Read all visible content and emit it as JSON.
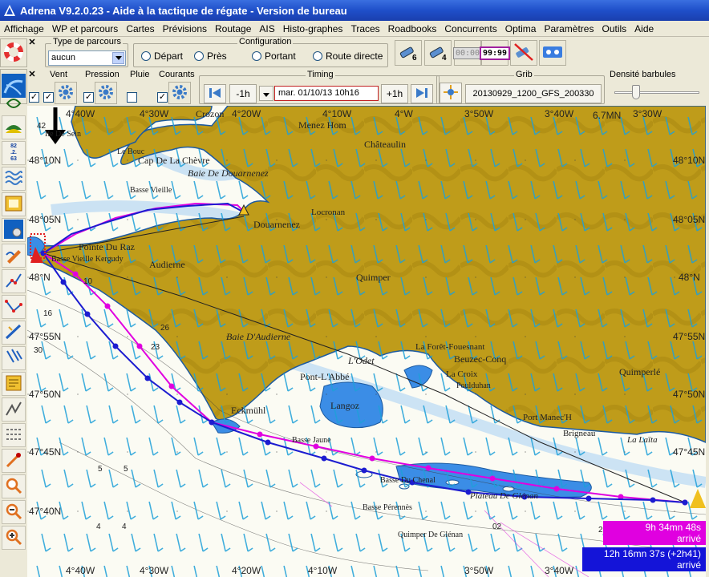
{
  "window": {
    "title": "Adrena V9.2.0.23 - Aide à la tactique de régate - Version de bureau"
  },
  "menu": [
    "Affichage",
    "WP et parcours",
    "Cartes",
    "Prévisions",
    "Routage",
    "AIS",
    "Histo-graphes",
    "Traces",
    "Roadbooks",
    "Concurrents",
    "Optima",
    "Paramètres",
    "Outils",
    "Aide"
  ],
  "toolbar": {
    "course_type_label": "Type de parcours",
    "course_type_value": "aucun",
    "config_label": "Configuration",
    "radios": [
      "Départ",
      "Près",
      "Portant",
      "Route directe"
    ],
    "btn_badge_6": "6",
    "btn_badge_4": "4",
    "btn_time_a": "00:00",
    "btn_time_b": "99:99"
  },
  "toolbar2": {
    "vent": "Vent",
    "pression": "Pression",
    "pluie": "Pluie",
    "courants": "Courants",
    "timing": "Timing",
    "minus_1h": "-1h",
    "date": "mar. 01/10/13 10h16",
    "plus_1h": "+1h",
    "grib_label": "Grib",
    "grib_file": "20130929_1200_GFS_200330",
    "density_label": "Densité barbules"
  },
  "map": {
    "lon_labels": [
      "4°40W",
      "4°30W",
      "4°20W",
      "4°10W",
      "4°W",
      "3°50W",
      "3°40W",
      "3°30W"
    ],
    "lat_labels": [
      "48°10N",
      "48°05N",
      "48°N",
      "47°55N",
      "47°50N",
      "47°45N",
      "47°40N"
    ],
    "places": [
      "Crozon",
      "Menez Hom",
      "Châteaulin",
      "Le Bouc",
      "Cap De La Chèvre",
      "Baie De Douarnenez",
      "Basse Vieille",
      "Douarnenez",
      "Locronan",
      "Pointe Du Raz",
      "Basse Vieille Kergudy",
      "Audierne",
      "Quimper",
      "Baie D'Audierne",
      "L'Odet",
      "La Forêt-Fouesnant",
      "Beuzec-Conq",
      "Pont-L'Abbé",
      "La Croix",
      "Poulduhan",
      "Quimperlé",
      "Langoz",
      "Eckmühl",
      "Port Manec'H",
      "Brigneau",
      "La Laïta",
      "Basse Du Chenal",
      "Basse Jaune",
      "Plateau De Glénan",
      "Basse Pérennès",
      "Quimper De Glénan",
      "Ile De Sein"
    ],
    "distance_label": "6.7MN",
    "depth_labels": [
      "42",
      "16",
      "26",
      "23",
      "5",
      "4",
      "02",
      "10",
      "20",
      "30"
    ],
    "route_magenta_time": "9h 34mn 48s",
    "route_magenta_status": "arrivé",
    "route_blue_time": "12h 16mn 37s (+2h41)",
    "route_blue_status": "arrivé"
  },
  "colors": {
    "land": "#bf9c1a",
    "land_dark": "#a8850f",
    "sea_deep": "#ffffff",
    "sea_shallow": "#3b8de6",
    "route_magenta": "#e000e0",
    "route_blue": "#1c1cd0",
    "barb": "#1fa0d8",
    "label_magenta_bg": "#e000e0",
    "label_blue_bg": "#1414d8"
  }
}
